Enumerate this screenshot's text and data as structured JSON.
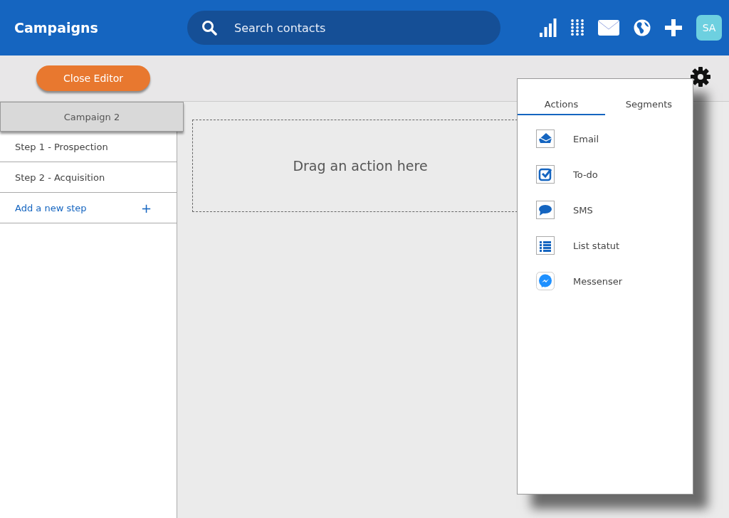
{
  "header": {
    "title": "Campaigns",
    "search": {
      "placeholder": "Search contacts"
    },
    "avatar": "SA"
  },
  "toolbar": {
    "close_button": "Close Editor"
  },
  "sidebar": {
    "campaign": "Campaign 2",
    "steps": [
      "Step 1 - Prospection",
      "Step 2 - Acquisition"
    ],
    "add_step": "Add a new step",
    "add_icon": "+"
  },
  "canvas": {
    "drop_zone": "Drag an action here"
  },
  "panel": {
    "tabs": [
      {
        "label": "Actions",
        "selected": true
      },
      {
        "label": "Segments",
        "selected": false
      }
    ],
    "items": [
      {
        "kind": "email",
        "label": "Email"
      },
      {
        "kind": "todo",
        "label": "To-do"
      },
      {
        "kind": "sms",
        "label": "SMS"
      },
      {
        "kind": "list",
        "label": "List statut"
      },
      {
        "kind": "messenger",
        "label": "Messenser"
      }
    ]
  }
}
